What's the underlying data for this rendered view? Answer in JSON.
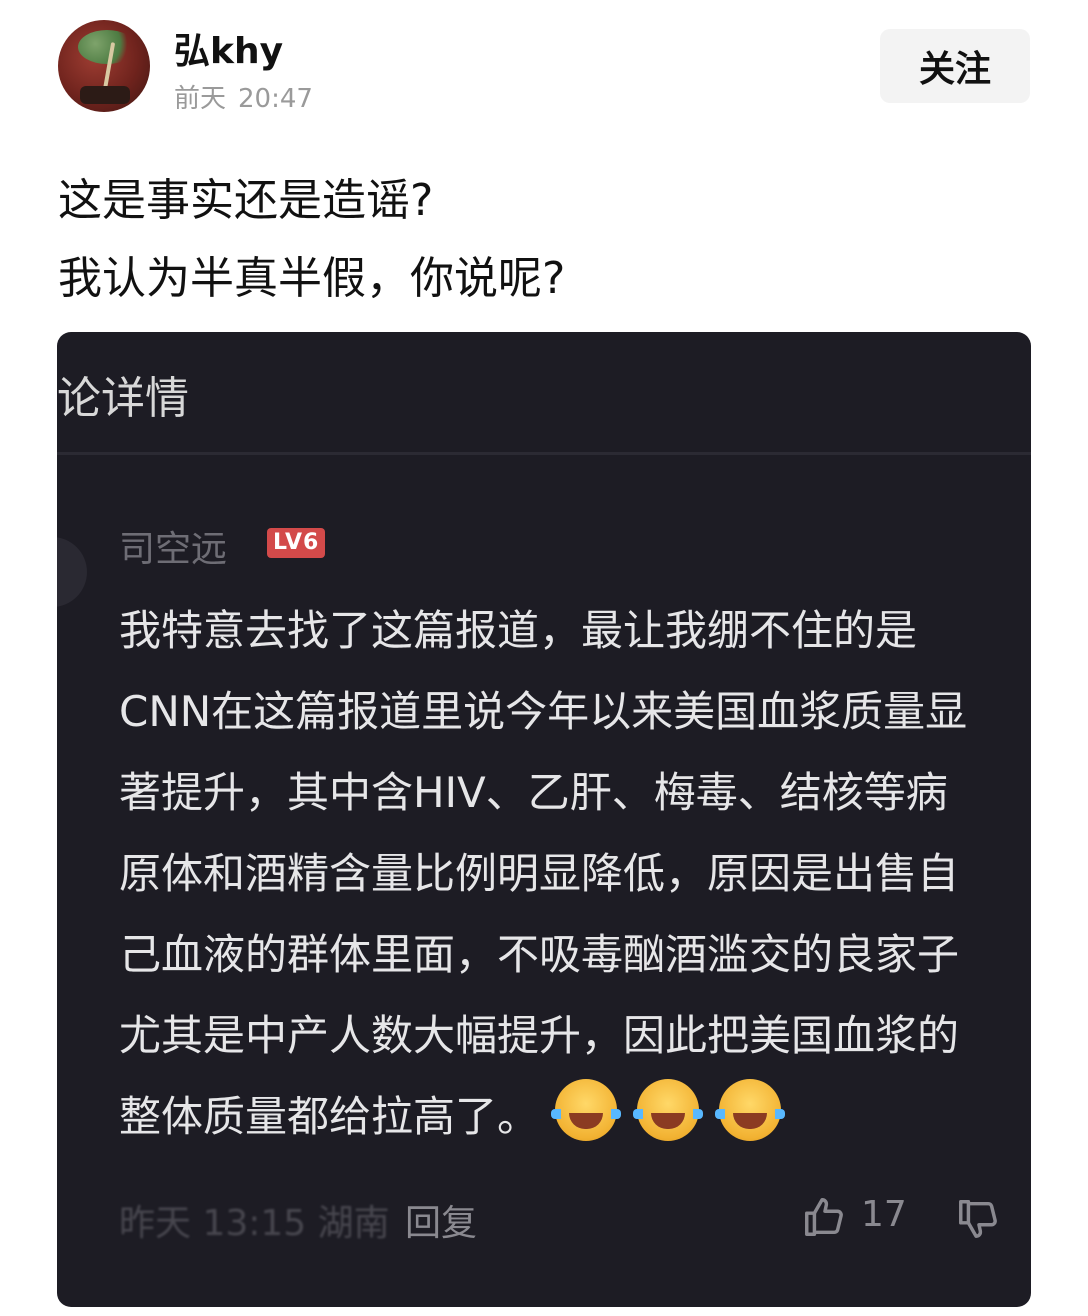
{
  "post": {
    "author": {
      "name": "弘khy",
      "date_label": "前天",
      "time": "20:47"
    },
    "follow_label": "关注",
    "text_lines": [
      "这是事实还是造谣?",
      "我认为半真半假，你说呢?"
    ]
  },
  "screenshot": {
    "title": "论详情",
    "comment": {
      "author": "司空远",
      "level": "LV6",
      "lines": [
        "我特意去找了这篇报道，最让我绷不住的是",
        "CNN在这篇报道里说今年以来美国血浆质量显",
        "著提升，其中含HIV、乙肝、梅毒、结核等病",
        "原体和酒精含量比例明显降低，原因是出售自",
        "己血液的群体里面，不吸毒酗酒滥交的良家子",
        "尤其是中产人数大幅提升，因此把美国血浆的",
        "整体质量都给拉高了。"
      ],
      "emoji_names": [
        "laughing-with-tears",
        "laughing-with-tears",
        "laughing-with-tears"
      ],
      "footer": {
        "date": "昨天 13:15 湖南",
        "reply_label": "回复",
        "like_count": "17"
      }
    }
  },
  "colors": {
    "screenshot_background": "#1d1c24",
    "level_badge": "#d34a4a",
    "follow_button_bg": "#f3f3f3"
  }
}
